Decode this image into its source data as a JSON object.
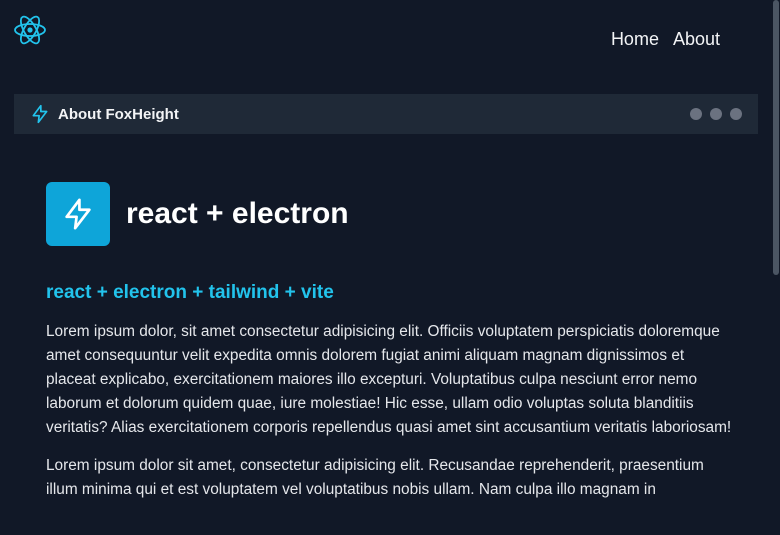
{
  "nav": {
    "logo_icon": "react-atom-icon",
    "links": [
      {
        "label": "Home"
      },
      {
        "label": "About"
      }
    ]
  },
  "window": {
    "icon": "lightning-bolt-icon",
    "title": "About FoxHeight",
    "controls": [
      "minimize-dot",
      "maximize-dot",
      "close-dot"
    ]
  },
  "main": {
    "hero_icon": "lightning-bolt-icon",
    "hero_title": "react + electron",
    "subtitle": "react + electron + tailwind + vite",
    "paragraphs": [
      "Lorem ipsum dolor, sit amet consectetur adipisicing elit. Officiis voluptatem perspiciatis doloremque amet consequuntur velit expedita omnis dolorem fugiat animi aliquam magnam dignissimos et placeat explicabo, exercitationem maiores illo excepturi. Voluptatibus culpa nesciunt error nemo laborum et dolorum quidem quae, iure molestiae! Hic esse, ullam odio voluptas soluta blanditiis veritatis? Alias exercitationem corporis repellendus quasi amet sint accusantium veritatis laboriosam!",
      "Lorem ipsum dolor sit amet, consectetur adipisicing elit. Recusandae reprehenderit, praesentium illum minima qui et est voluptatem vel voluptatibus nobis ullam. Nam culpa illo magnam in"
    ]
  },
  "colors": {
    "background": "#111827",
    "window_bar": "#1f2937",
    "accent": "#22c3ec",
    "hero_icon_bg": "#0ea5d9",
    "dot": "#6b7280"
  }
}
